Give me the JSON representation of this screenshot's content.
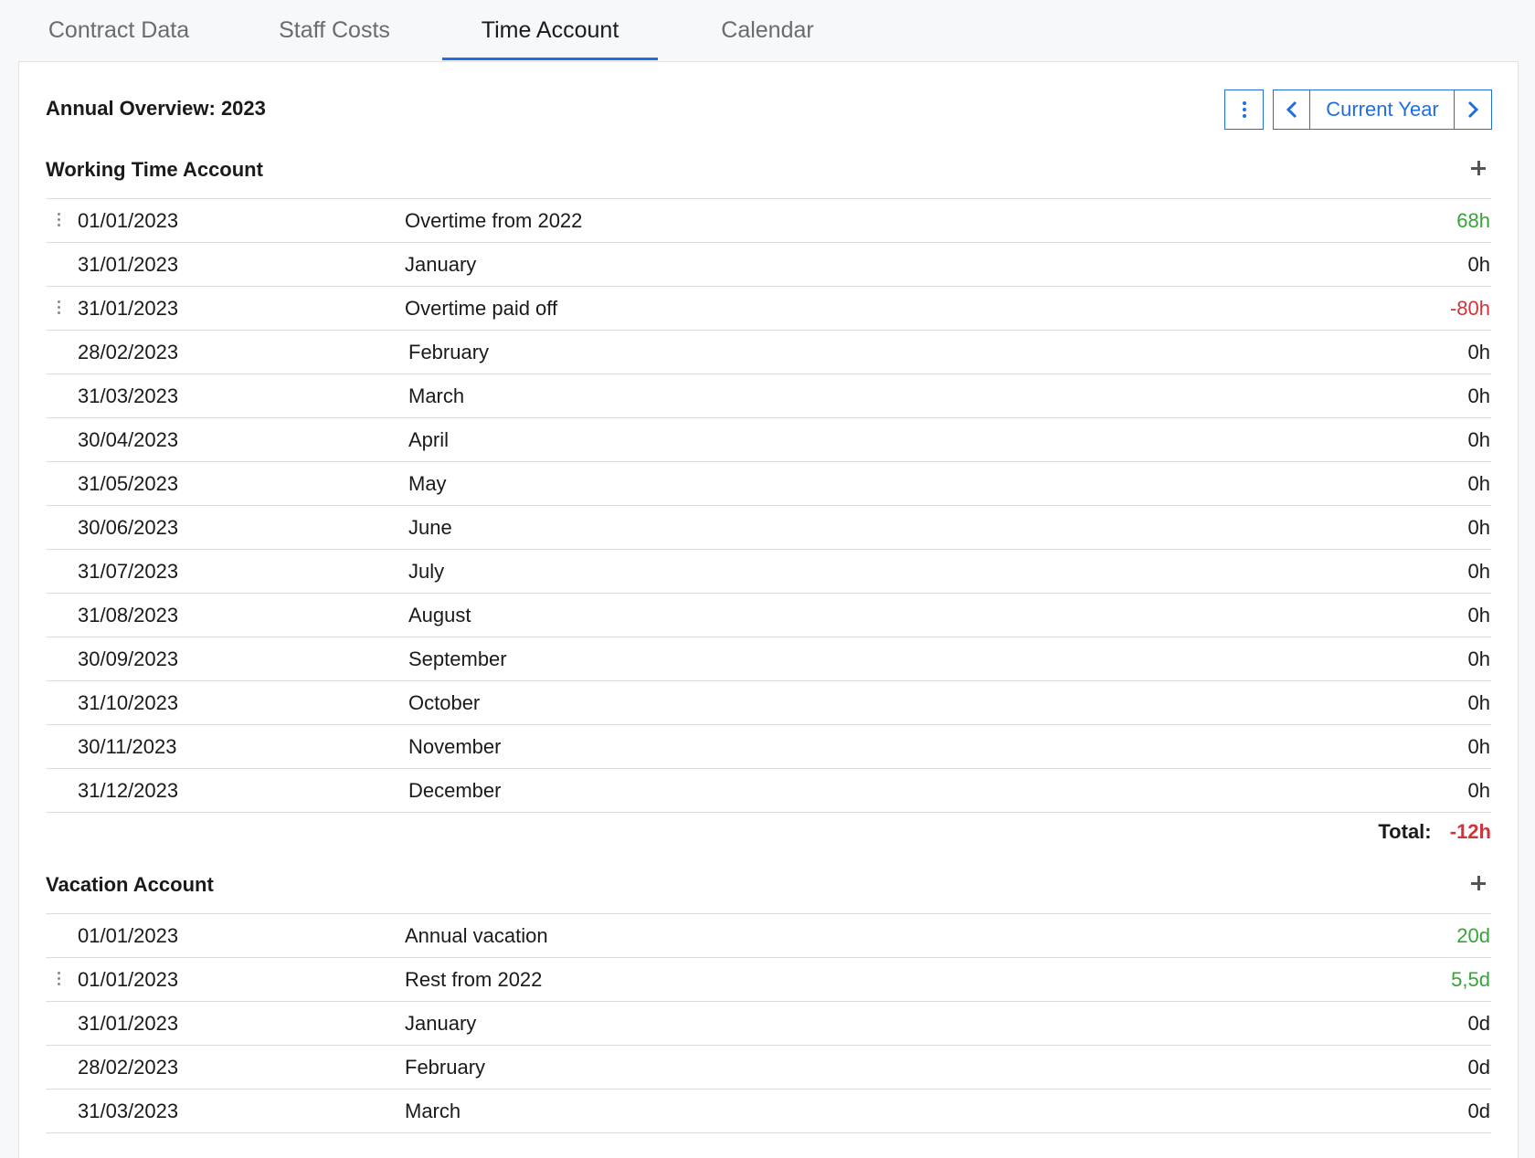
{
  "tabs": [
    {
      "label": "Contract Data",
      "active": false
    },
    {
      "label": "Staff Costs",
      "active": false
    },
    {
      "label": "Time Account",
      "active": true
    },
    {
      "label": "Calendar",
      "active": false
    }
  ],
  "overview": {
    "title": "Annual Overview: 2023",
    "period_label": "Current Year"
  },
  "working_time": {
    "title": "Working Time Account",
    "rows": [
      {
        "date": "01/01/2023",
        "desc": "Overtime from 2022",
        "value": "68h",
        "kind": "pos",
        "handle": true
      },
      {
        "date": "31/01/2023",
        "desc": "January",
        "value": "0h",
        "kind": "zero",
        "handle": false
      },
      {
        "date": "31/01/2023",
        "desc": "Overtime paid off",
        "value": "-80h",
        "kind": "neg",
        "handle": true
      },
      {
        "date": "28/02/2023",
        "desc": "February",
        "value": "0h",
        "kind": "zero",
        "handle": false
      },
      {
        "date": "31/03/2023",
        "desc": "March",
        "value": "0h",
        "kind": "zero",
        "handle": false
      },
      {
        "date": "30/04/2023",
        "desc": "April",
        "value": "0h",
        "kind": "zero",
        "handle": false
      },
      {
        "date": "31/05/2023",
        "desc": "May",
        "value": "0h",
        "kind": "zero",
        "handle": false
      },
      {
        "date": "30/06/2023",
        "desc": "June",
        "value": "0h",
        "kind": "zero",
        "handle": false
      },
      {
        "date": "31/07/2023",
        "desc": "July",
        "value": "0h",
        "kind": "zero",
        "handle": false
      },
      {
        "date": "31/08/2023",
        "desc": "August",
        "value": "0h",
        "kind": "zero",
        "handle": false
      },
      {
        "date": "30/09/2023",
        "desc": "September",
        "value": "0h",
        "kind": "zero",
        "handle": false
      },
      {
        "date": "31/10/2023",
        "desc": "October",
        "value": "0h",
        "kind": "zero",
        "handle": false
      },
      {
        "date": "30/11/2023",
        "desc": "November",
        "value": "0h",
        "kind": "zero",
        "handle": false
      },
      {
        "date": "31/12/2023",
        "desc": "December",
        "value": "0h",
        "kind": "zero",
        "handle": false
      }
    ],
    "total_label": "Total:",
    "total_value": "-12h"
  },
  "vacation": {
    "title": "Vacation Account",
    "rows": [
      {
        "date": "01/01/2023",
        "desc": "Annual vacation",
        "value": "20d",
        "kind": "pos",
        "handle": false
      },
      {
        "date": "01/01/2023",
        "desc": "Rest from 2022",
        "value": "5,5d",
        "kind": "pos",
        "handle": true
      },
      {
        "date": "31/01/2023",
        "desc": "January",
        "value": "0d",
        "kind": "zero",
        "handle": false
      },
      {
        "date": "28/02/2023",
        "desc": "February",
        "value": "0d",
        "kind": "zero",
        "handle": false
      },
      {
        "date": "31/03/2023",
        "desc": "March",
        "value": "0d",
        "kind": "zero",
        "handle": false
      }
    ]
  },
  "colors": {
    "accent": "#1f6fe0",
    "positive": "#3aa23a",
    "negative": "#d0343b"
  },
  "icons": {
    "menu": "vertical-dots-icon",
    "prev": "chevron-left-icon",
    "next": "chevron-right-icon",
    "add": "plus-icon",
    "drag": "drag-handle-icon"
  }
}
